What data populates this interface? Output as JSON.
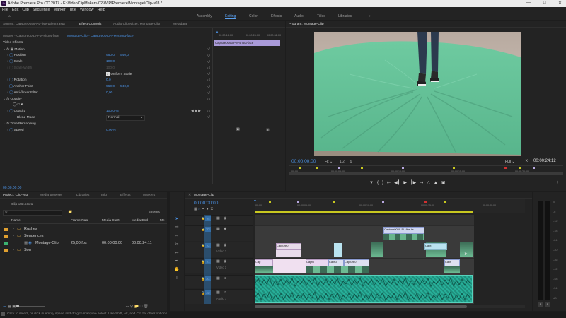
{
  "titlebar": {
    "title": "Adobe Premiere Pro CC 2017 - E:\\VideoClipMakers-02\\WIP\\Premiere\\Montage\\Clip-v03 *",
    "app_icon": "Pr"
  },
  "menu": [
    "File",
    "Edit",
    "Clip",
    "Sequence",
    "Marker",
    "Title",
    "Window",
    "Help"
  ],
  "workspaces": [
    "Assembly",
    "Editing",
    "Color",
    "Effects",
    "Audio",
    "Titles",
    "Libraries"
  ],
  "active_workspace": "Editing",
  "source_panel": {
    "tabs": [
      "Source: Capture0059-PL-five-talent-rasta",
      "Effect Controls",
      "Audio Clip Mixer: Montage-Clip",
      "Metadata"
    ],
    "active_tab": "Effect Controls",
    "master_label": "Master * Capture0063-PM-shoot-face",
    "clip_label": "Montage-Clip * Capture0063-PM-shoot-face",
    "mini_timecodes": [
      "00:00:16:00",
      "00:00:24:00",
      "00:00:32:00"
    ],
    "mini_clip": "Capture0063-PM-shoot-face",
    "section_video": "Video Effects",
    "fx_motion": "Motion",
    "props": [
      {
        "label": "Position",
        "v1": "960,0",
        "v2": "540,0"
      },
      {
        "label": "Scale",
        "v1": "100,0",
        "v2": ""
      },
      {
        "label": "Scale Width",
        "v1": "100,0",
        "v2": ""
      },
      {
        "label": "Rotation",
        "v1": "0,0",
        "v2": ""
      },
      {
        "label": "Anchor Point",
        "v1": "960,0",
        "v2": "540,0"
      },
      {
        "label": "Anti-flicker Filter",
        "v1": "0,00",
        "v2": ""
      }
    ],
    "uniform_scale": "Uniform Scale",
    "fx_opacity": "Opacity",
    "opacity_label": "Opacity",
    "opacity_value": "100,0 %",
    "blend_label": "Blend Mode",
    "blend_value": "Normal",
    "fx_time": "Time Remapping",
    "speed_label": "Speed",
    "speed_value": "0,00%",
    "timecode": "00:00:00:00"
  },
  "program_panel": {
    "title": "Program: Montage-Clip",
    "timecode_left": "00:00:00:00",
    "fit": "Fit",
    "fraction": "1/2",
    "quality": "Full",
    "timecode_right": "00:00:24:12",
    "ruler_labels": [
      "00:00",
      "00:00:05:00",
      "00:00:10:00",
      "00:00:15:00",
      "00:00:20:00"
    ]
  },
  "project_panel": {
    "tabs": [
      "Project: Clip-v03",
      "Media Browser",
      "Libraries",
      "Info",
      "Effects",
      "Markers"
    ],
    "active_tab": "Project: Clip-v03",
    "file": "Clip-v03.prproj",
    "items_count": "6 Items",
    "columns": [
      "Name",
      "Frame Rate",
      "Media Start",
      "Media End",
      "Me"
    ],
    "rows": [
      {
        "name": "Rushes",
        "rate": "",
        "start": "",
        "end": "",
        "color": "#e0a030",
        "indent": 0,
        "kind": "bin"
      },
      {
        "name": "Sequences",
        "rate": "",
        "start": "",
        "end": "",
        "color": "#e0a030",
        "indent": 0,
        "kind": "bin"
      },
      {
        "name": "Montage-Clip",
        "rate": "25,00 fps",
        "start": "00:00:00:00",
        "end": "00:00:24:11",
        "color": "#3cb371",
        "indent": 1,
        "kind": "seq"
      },
      {
        "name": "Son",
        "rate": "",
        "start": "",
        "end": "",
        "color": "#e0a030",
        "indent": 0,
        "kind": "bin"
      }
    ]
  },
  "timeline_panel": {
    "tab": "Montage-Clip",
    "timecode": "00:00:00:00",
    "ruler_labels": [
      ":00:00",
      "00:00:05:00",
      "00:00:10:00",
      "00:00:15:00",
      "00:00:20:00"
    ],
    "tracks": [
      {
        "name": "V4",
        "label": ""
      },
      {
        "name": "V3",
        "label": ""
      },
      {
        "name": "V2",
        "label": "Video 2"
      },
      {
        "name": "V1",
        "label": "Video 1"
      },
      {
        "name": "A1",
        "label": ""
      },
      {
        "name": "A2",
        "label": "Audio 1"
      }
    ],
    "clips_v3": [
      {
        "label": "Capture0059-PL-five-ta"
      }
    ],
    "clips_v2": [
      {
        "label": "Capture0"
      },
      {
        "label": "Capt"
      }
    ],
    "clips_v1": [
      {
        "label": "Cap"
      },
      {
        "label": "Captu"
      },
      {
        "label": "Captu"
      },
      {
        "label": "Capture0"
      },
      {
        "label": "Capt"
      }
    ],
    "meter_labels": [
      "0",
      "-6",
      "-12",
      "-18",
      "-24",
      "-30",
      "-36",
      "-42",
      "-48",
      "-54",
      "dB"
    ],
    "meter_solo": [
      "S",
      "S"
    ]
  },
  "status": {
    "message": "Click to select, or click in empty space and drag to marquee select. Use Shift, Alt, and Ctrl for other options."
  },
  "colors": {
    "accent": "#4a90e2",
    "video_clip": "#6e6f8c",
    "audio_clip": "#2fb79a",
    "timecode": "#4a90e2"
  }
}
